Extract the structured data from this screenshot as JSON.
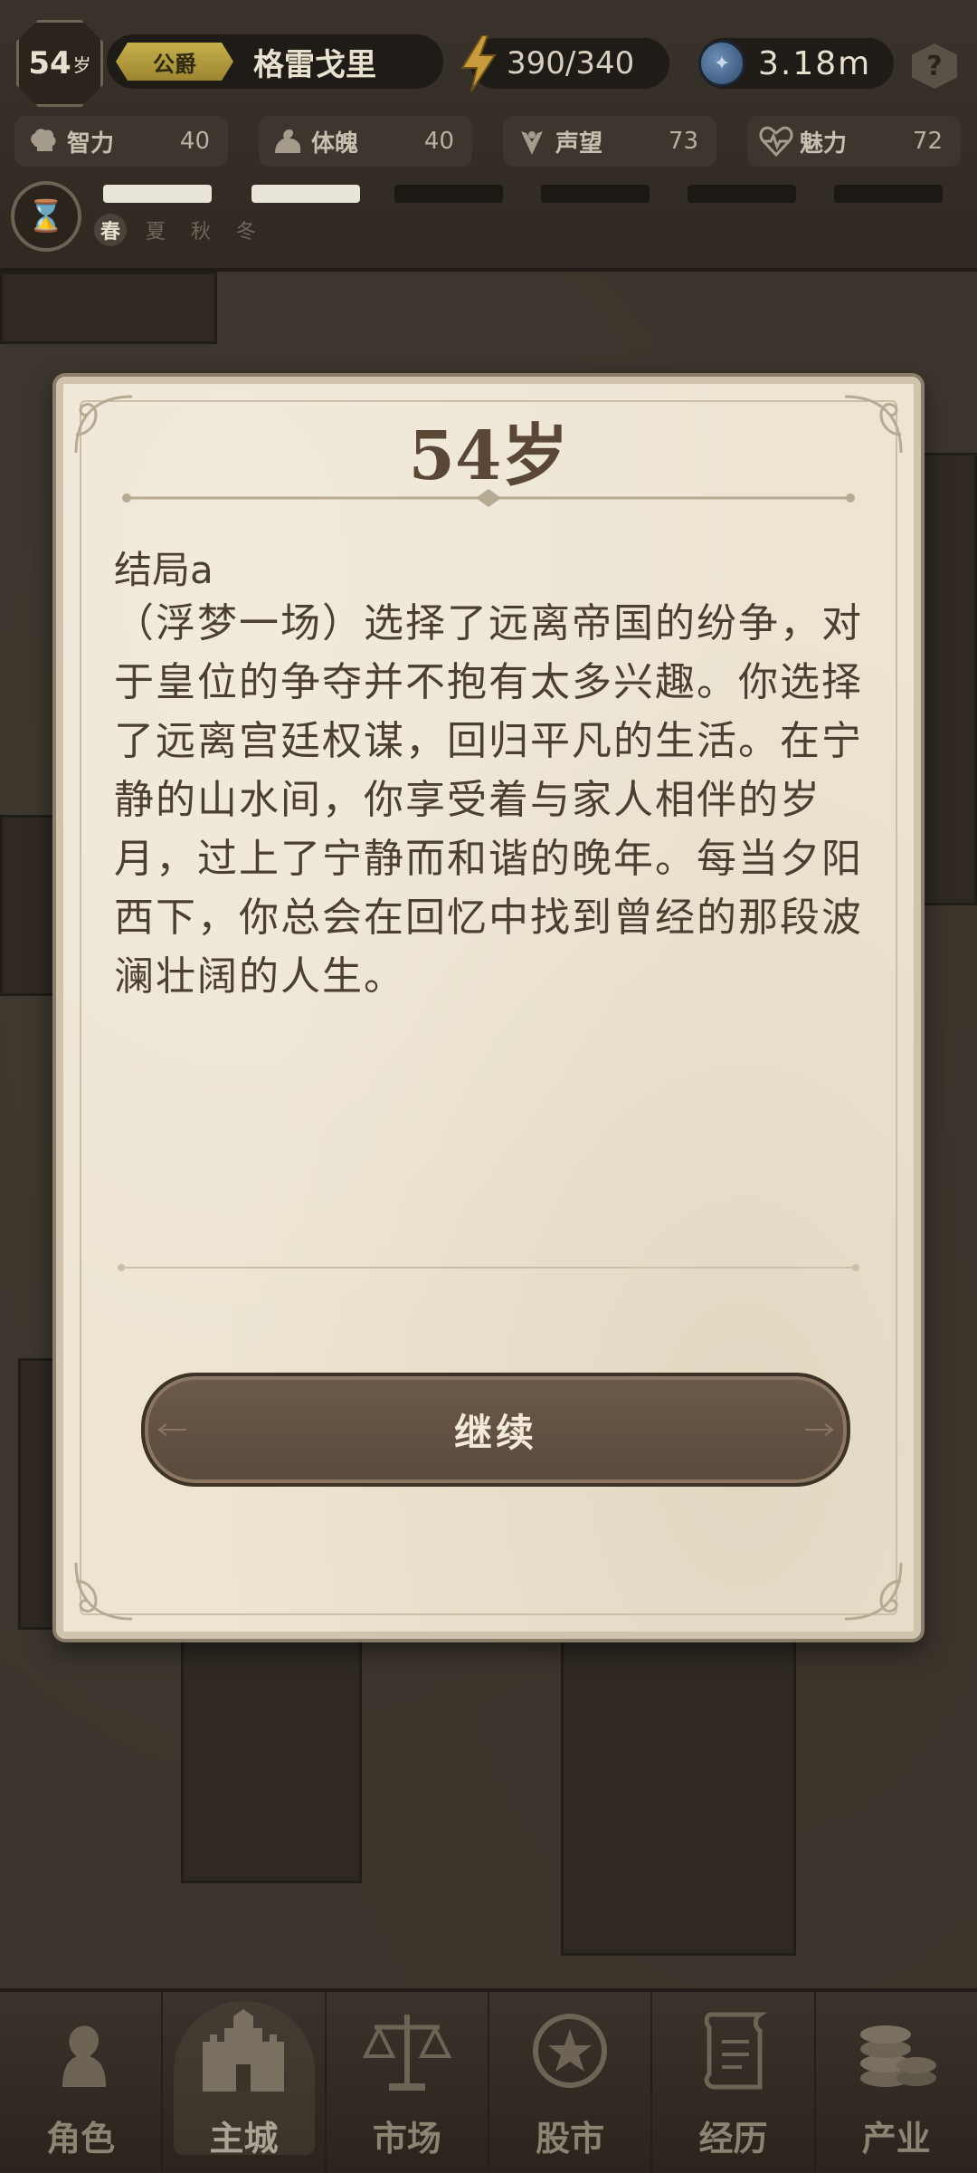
{
  "player": {
    "age": "54",
    "age_unit": "岁",
    "title": "公爵",
    "name": "格雷戈里",
    "energy": "390/340",
    "money": "3.18m"
  },
  "stats": [
    {
      "label": "智力",
      "value": "40",
      "icon": "brain-icon"
    },
    {
      "label": "体魄",
      "value": "40",
      "icon": "muscle-icon"
    },
    {
      "label": "声望",
      "value": "73",
      "icon": "laurel-icon"
    },
    {
      "label": "魅力",
      "value": "72",
      "icon": "heartbeat-icon"
    }
  ],
  "seasons": [
    "春",
    "夏",
    "秋",
    "冬"
  ],
  "current_season_index": 0,
  "dialog": {
    "title": "54岁",
    "ending_label": "结局a",
    "story": "（浮梦一场）选择了远离帝国的纷争，对于皇位的争夺并不抱有太多兴趣。你选择了远离宫廷权谋，回归平凡的生活。在宁静的山水间，你享受着与家人相伴的岁月，过上了宁静而和谐的晚年。每当夕阳西下，你总会在回忆中找到曾经的那段波澜壮阔的人生。",
    "continue_label": "继续"
  },
  "nav": [
    {
      "label": "角色",
      "icon": "character-icon"
    },
    {
      "label": "主城",
      "icon": "castle-icon"
    },
    {
      "label": "市场",
      "icon": "scales-icon"
    },
    {
      "label": "股市",
      "icon": "stock-icon"
    },
    {
      "label": "经历",
      "icon": "scroll-icon"
    },
    {
      "label": "产业",
      "icon": "coins-icon"
    }
  ],
  "active_nav_index": 1,
  "colors": {
    "parchment": "#ede4d2",
    "dark_brown": "#4b3f33",
    "button": "#5a4a3c",
    "title_tag": "#c7b04b"
  }
}
